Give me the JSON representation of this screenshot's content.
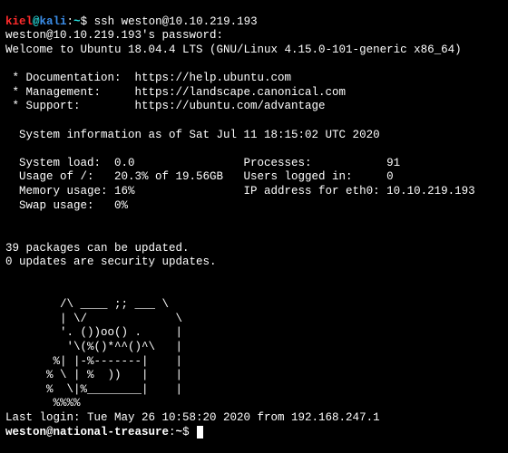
{
  "local_prompt": {
    "user": "kiel",
    "at": "@",
    "host": "kali",
    "colon": ":",
    "path": "~",
    "symbol": "$ ",
    "command": "ssh weston@10.10.219.193"
  },
  "password_prompt": "weston@10.10.219.193's password:",
  "welcome": "Welcome to Ubuntu 18.04.4 LTS (GNU/Linux 4.15.0-101-generic x86_64)",
  "links": {
    "doc": " * Documentation:  https://help.ubuntu.com",
    "management": " * Management:     https://landscape.canonical.com",
    "support": " * Support:        https://ubuntu.com/advantage"
  },
  "sysinfo_header": "  System information as of Sat Jul 11 18:15:02 UTC 2020",
  "sysinfo": {
    "line1": "  System load:  0.0                Processes:           91",
    "line2": "  Usage of /:   20.3% of 19.56GB   Users logged in:     0",
    "line3": "  Memory usage: 16%                IP address for eth0: 10.10.219.193",
    "line4": "  Swap usage:   0%"
  },
  "updates": {
    "line1": "39 packages can be updated.",
    "line2": "0 updates are security updates."
  },
  "motd": {
    "l1": "        /\\ ____ ;; ___ \\",
    "l2": "        | \\/             \\",
    "l3": "        '. ())oo() .     |",
    "l4": "         '\\(%()*^^()^\\   |",
    "l5": "       %| |-%-------|    |",
    "l6": "      % \\ | %  ))   |    |",
    "l7": "      %  \\|%________|    |",
    "l8": "       %%%%",
    "l9": "Last login: Tue May 26 10:58:20 2020 from 192.168.247.1"
  },
  "remote_prompt": {
    "userhost": "weston@national-treasure",
    "colon": ":",
    "path": "~",
    "symbol": "$ "
  }
}
